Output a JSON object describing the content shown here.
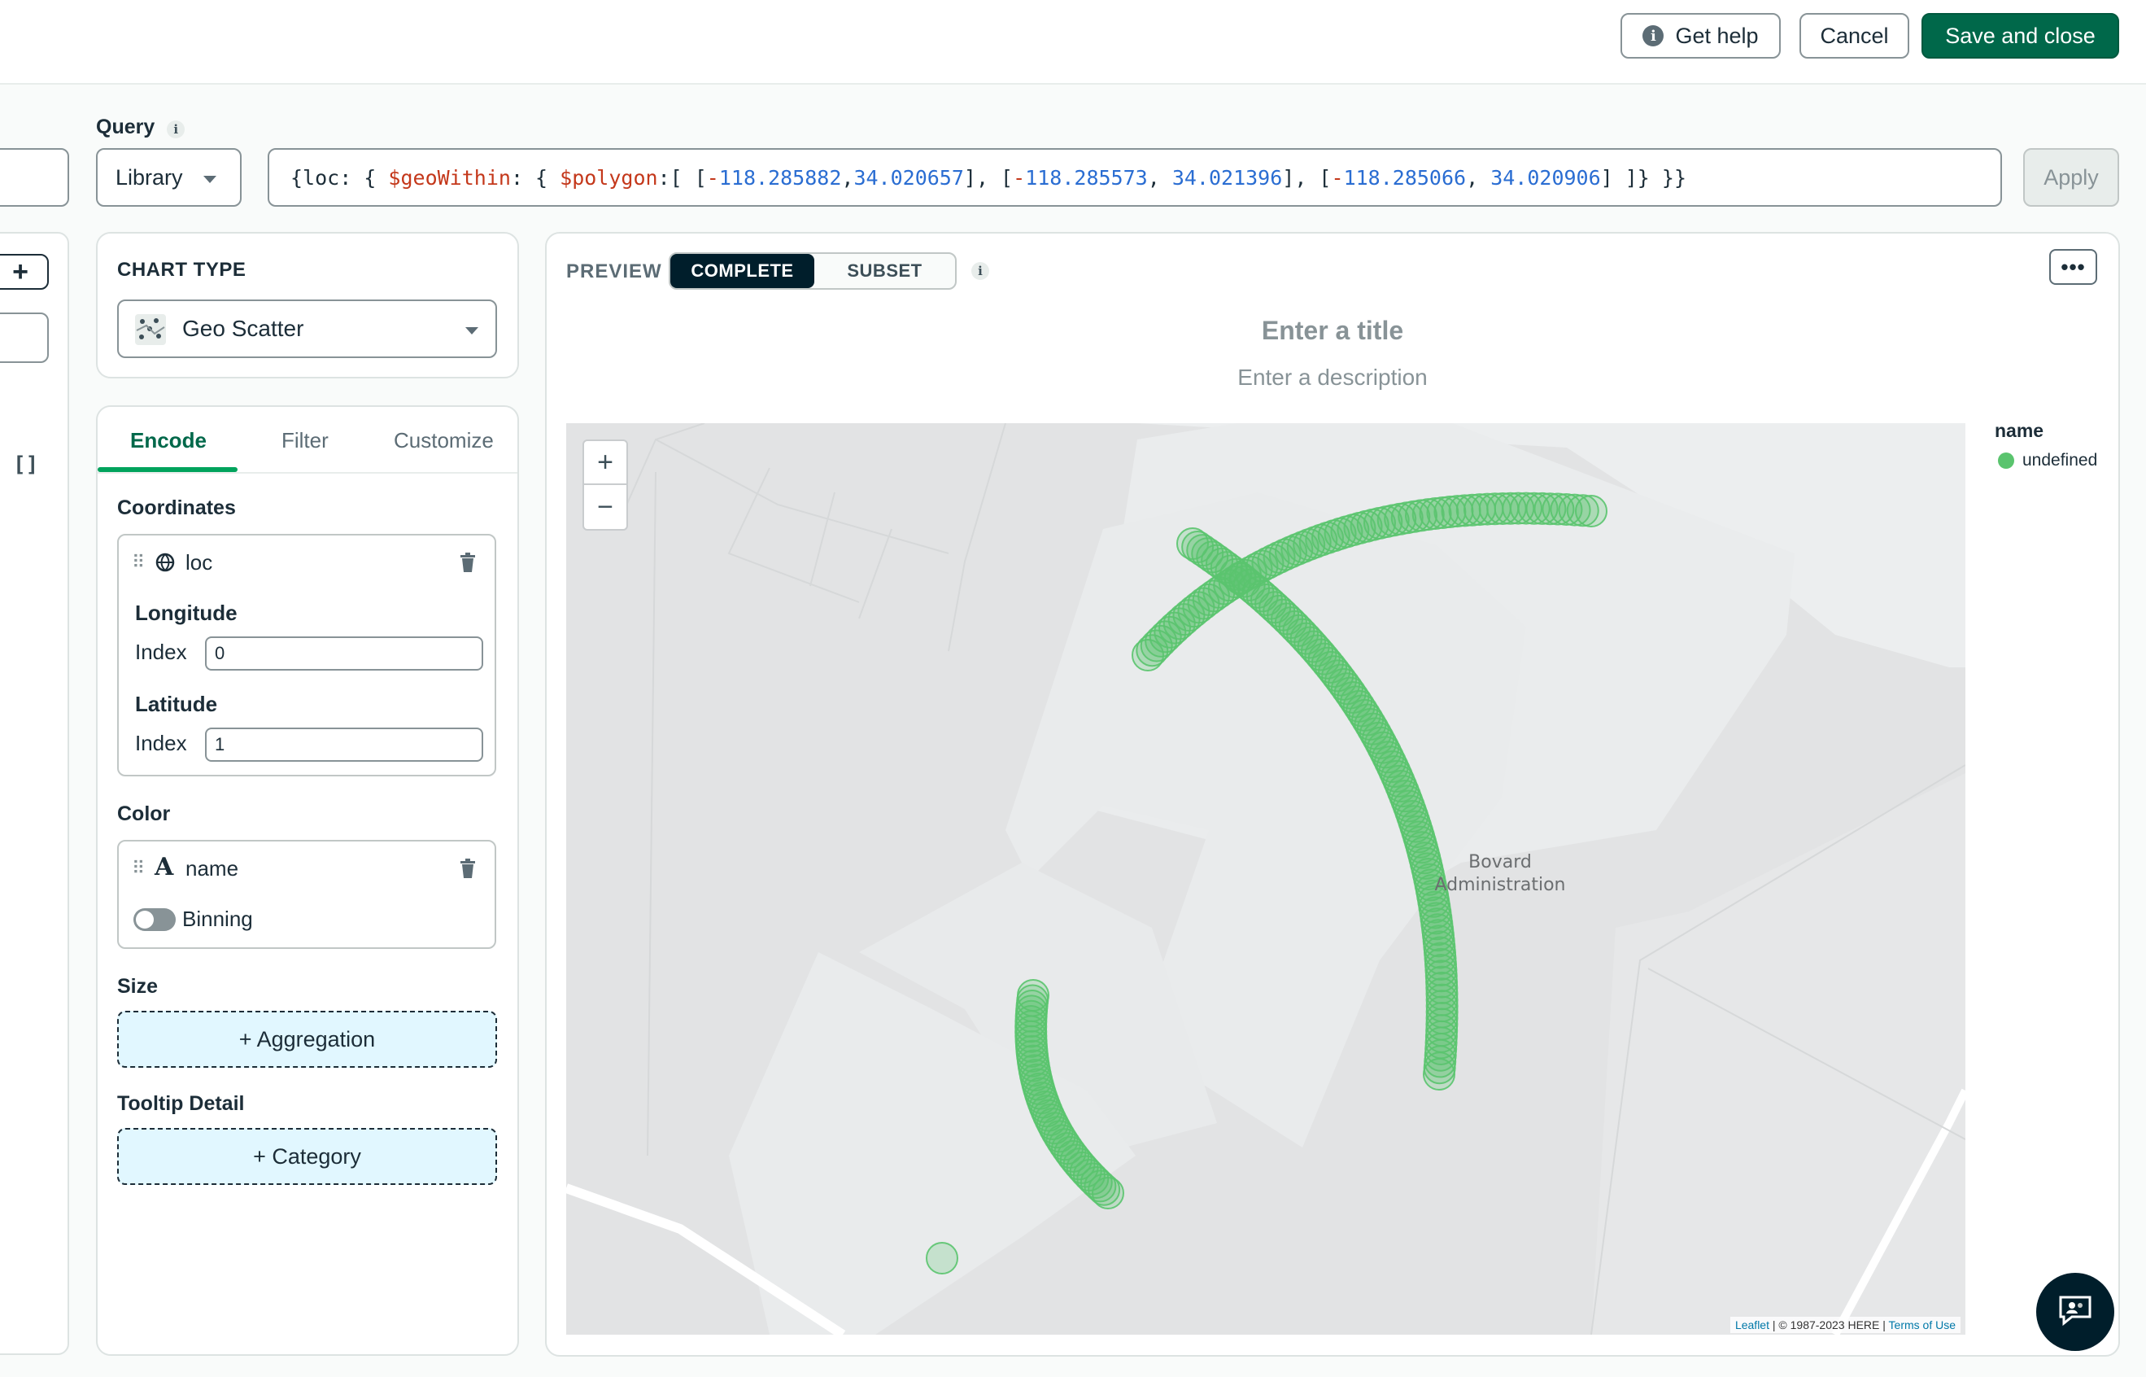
{
  "header": {
    "get_help_label": "Get help",
    "cancel_label": "Cancel",
    "save_close_label": "Save and close"
  },
  "query": {
    "label": "Query",
    "library_label": "Library",
    "text": "{loc: { $geoWithin: { $polygon:[ [-118.285882,34.020657], [-118.285573, 34.021396], [-118.285066, 34.020906] ]} }}",
    "apply_label": "Apply"
  },
  "chart_type": {
    "title": "CHART TYPE",
    "selected": "Geo Scatter"
  },
  "tabs": [
    {
      "label": "Encode"
    },
    {
      "label": "Filter"
    },
    {
      "label": "Customize"
    }
  ],
  "encode": {
    "coordinates": {
      "title": "Coordinates",
      "field": "loc",
      "longitude_title": "Longitude",
      "longitude_index_label": "Index",
      "longitude_index_value": "0",
      "latitude_title": "Latitude",
      "latitude_index_label": "Index",
      "latitude_index_value": "1"
    },
    "color": {
      "title": "Color",
      "field": "name",
      "binning_label": "Binning"
    },
    "size": {
      "title": "Size",
      "dropzone_label": "+ Aggregation"
    },
    "tooltip": {
      "title": "Tooltip Detail",
      "dropzone_label": "+ Category"
    }
  },
  "preview": {
    "label": "PREVIEW",
    "complete_label": "COMPLETE",
    "subset_label": "SUBSET",
    "more_label": "•••",
    "title_placeholder": "Enter a title",
    "description_placeholder": "Enter a description"
  },
  "map": {
    "zoom_in": "+",
    "zoom_out": "−",
    "place_label_line1": "Bovard",
    "place_label_line2": "Administration",
    "attribution_leaflet": "Leaflet",
    "attribution_text": "| © 1987-2023 HERE |",
    "attribution_terms": "Terms of Use",
    "point_color": "#5ac46e"
  },
  "legend": {
    "title": "name",
    "item": "undefined"
  },
  "left_panel": {
    "add_label": "+",
    "array_glyph": "[]"
  },
  "colors": {
    "primary": "#00684a",
    "accent_green": "#00a35c",
    "dark": "#001e2b"
  }
}
